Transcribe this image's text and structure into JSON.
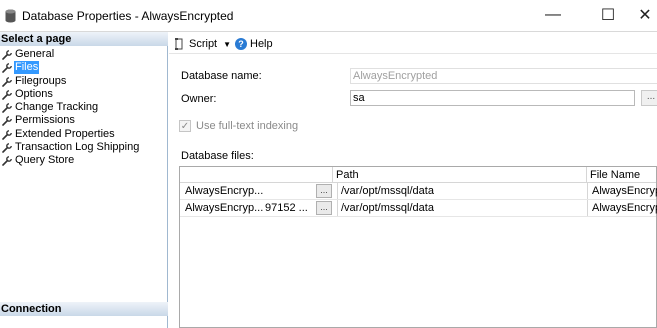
{
  "window": {
    "title": "Database Properties - AlwaysEncrypted",
    "minimize_glyph": "—",
    "maximize_glyph": "☐",
    "close_glyph": "✕"
  },
  "left_pane": {
    "select_page_header": "Select a page",
    "pages": [
      {
        "label": "General",
        "icon": "wrench-icon",
        "selected": false
      },
      {
        "label": "Files",
        "icon": "wrench-icon",
        "selected": true
      },
      {
        "label": "Filegroups",
        "icon": "wrench-icon",
        "selected": false
      },
      {
        "label": "Options",
        "icon": "wrench-icon",
        "selected": false
      },
      {
        "label": "Change Tracking",
        "icon": "wrench-icon",
        "selected": false
      },
      {
        "label": "Permissions",
        "icon": "wrench-icon",
        "selected": false
      },
      {
        "label": "Extended Properties",
        "icon": "wrench-icon",
        "selected": false
      },
      {
        "label": "Transaction Log Shipping",
        "icon": "wrench-icon",
        "selected": false
      },
      {
        "label": "Query Store",
        "icon": "wrench-icon",
        "selected": false
      }
    ],
    "connection_header": "Connection"
  },
  "toolbar": {
    "script_label": "Script",
    "help_label": "Help",
    "help_glyph": "?"
  },
  "form": {
    "database_name_label": "Database name:",
    "database_name_value": "AlwaysEncrypted",
    "owner_label": "Owner:",
    "owner_value": "sa",
    "owner_browse": "...",
    "fulltext_label": "Use full-text indexing",
    "fulltext_checked": true,
    "database_files_label": "Database files:"
  },
  "files_grid": {
    "columns": [
      "",
      "",
      "Path",
      "File Name"
    ],
    "rows": [
      {
        "logical_name": "AlwaysEncryp...",
        "size": "",
        "browse": "...",
        "path": "/var/opt/mssql/data",
        "file_name": "AlwaysEncryp"
      },
      {
        "logical_name": "AlwaysEncryp...",
        "size": "97152 ...",
        "browse": "...",
        "path": "/var/opt/mssql/data",
        "file_name": "AlwaysEncryp"
      }
    ]
  },
  "colors": {
    "selection": "#3399ff",
    "header_gradient_top": "#eef3f9",
    "header_gradient_bottom": "#c9d8e8",
    "help_icon": "#2a7bd4"
  }
}
